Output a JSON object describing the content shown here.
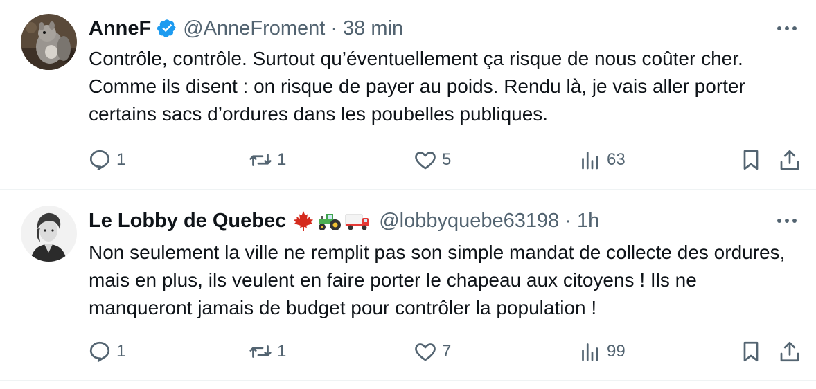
{
  "tweets": [
    {
      "display_name": "AnneF",
      "handle": "@AnneFroment",
      "separator": "·",
      "time": "38 min",
      "verified": true,
      "text": "Contrôle, contrôle. Surtout qu’éventuellement ça risque de nous coûter cher. Comme ils disent : on risque de payer au poids. Rendu là, je vais aller porter certains sacs d’ordures dans les poubelles publiques.",
      "stats": {
        "replies": "1",
        "retweets": "1",
        "likes": "5",
        "views": "63"
      }
    },
    {
      "display_name": "Le Lobby de Quebec",
      "handle": "@lobbyquebe63198",
      "separator": "·",
      "time": "1h",
      "verified": false,
      "emojis": [
        "maple-leaf-emoji",
        "tractor-emoji",
        "truck-emoji"
      ],
      "text": "Non seulement la ville ne remplit pas son simple mandat de collecte des ordures, mais en plus, ils veulent en faire porter le chapeau aux citoyens ! Ils ne manqueront jamais de budget pour contrôler la population !",
      "stats": {
        "replies": "1",
        "retweets": "1",
        "likes": "7",
        "views": "99"
      }
    }
  ],
  "colors": {
    "text_primary": "#0f1419",
    "text_secondary": "#536471",
    "verified_blue": "#1d9bf0",
    "divider": "#eff3f4"
  }
}
